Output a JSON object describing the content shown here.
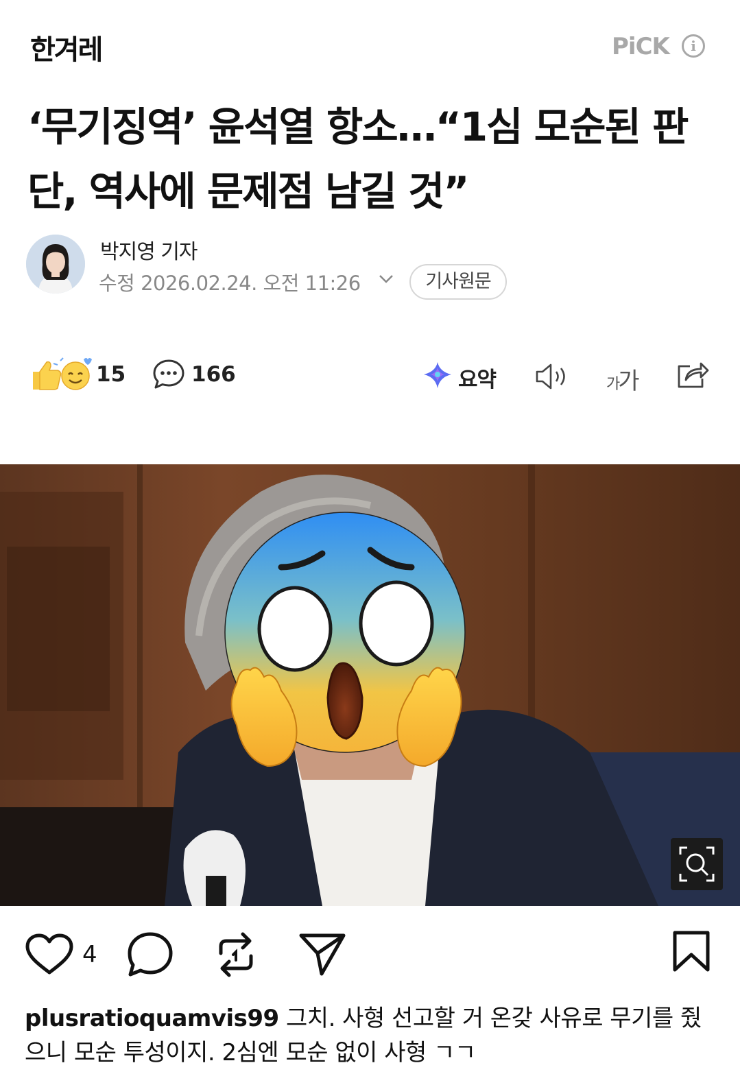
{
  "header": {
    "brand": "한겨레",
    "pick": "PiCK",
    "info_glyph": "i"
  },
  "article": {
    "headline": "‘무기징역’ 윤석열 항소…“1심 모순된 판단, 역사에 문제점 남길 것”",
    "author": "박지영 기자",
    "timestamp": "수정 2026.02.24. 오전 11:26",
    "original_button": "기사원문"
  },
  "actions": {
    "reactions": "15",
    "comments": "166",
    "summary": "요약",
    "font_size_big": "가",
    "font_size_small": "가"
  },
  "post": {
    "likes": "4",
    "username": "plusratioquamvis99",
    "text": " 그치. 사형 선고할 거 온갖 사유로 무기를 줬으니 모순 투성이지. 2심엔 모순 없이 사형 ㄱㄱ"
  },
  "icons": {
    "info": "info-icon",
    "chevron": "chevron-down-icon",
    "reaction": "thumbs-up-smile-icon",
    "comment": "speech-bubble-icon",
    "summary": "ai-sparkle-icon",
    "speaker": "speaker-icon",
    "font": "font-size-icon",
    "share": "share-icon",
    "zoom": "zoom-icon",
    "like": "heart-icon",
    "reply": "reply-bubble-icon",
    "repost": "repost-icon",
    "send": "send-icon",
    "bookmark": "bookmark-icon",
    "face_cover": "face-screaming-emoji"
  }
}
